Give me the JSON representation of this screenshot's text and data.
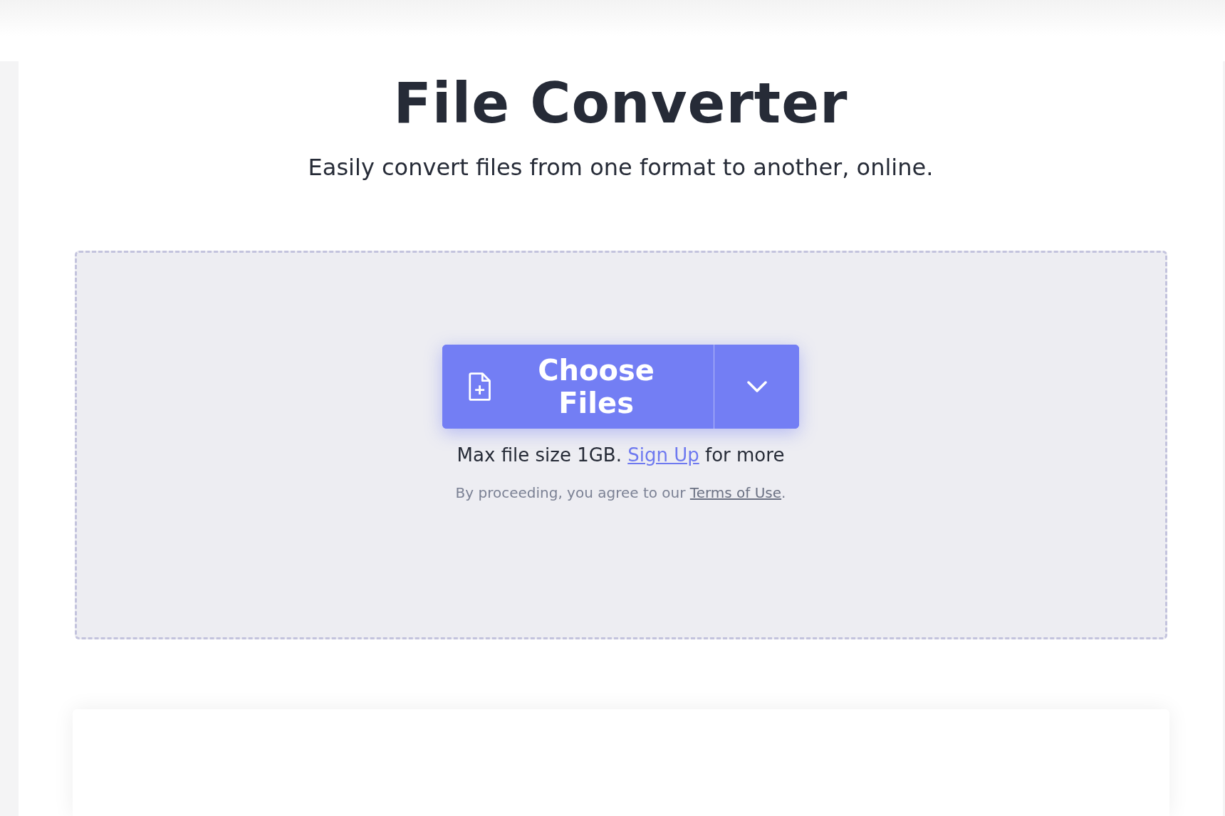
{
  "heading": {
    "title": "File Converter",
    "subtitle": "Easily convert files from one format to another, online."
  },
  "upload": {
    "button_label": "Choose Files",
    "size_note": {
      "before": "Max file size 1GB.",
      "link": "Sign Up",
      "after": "for more"
    },
    "terms_note": {
      "before": "By proceeding, you agree to our",
      "link": "Terms of Use",
      "after": "."
    }
  }
}
